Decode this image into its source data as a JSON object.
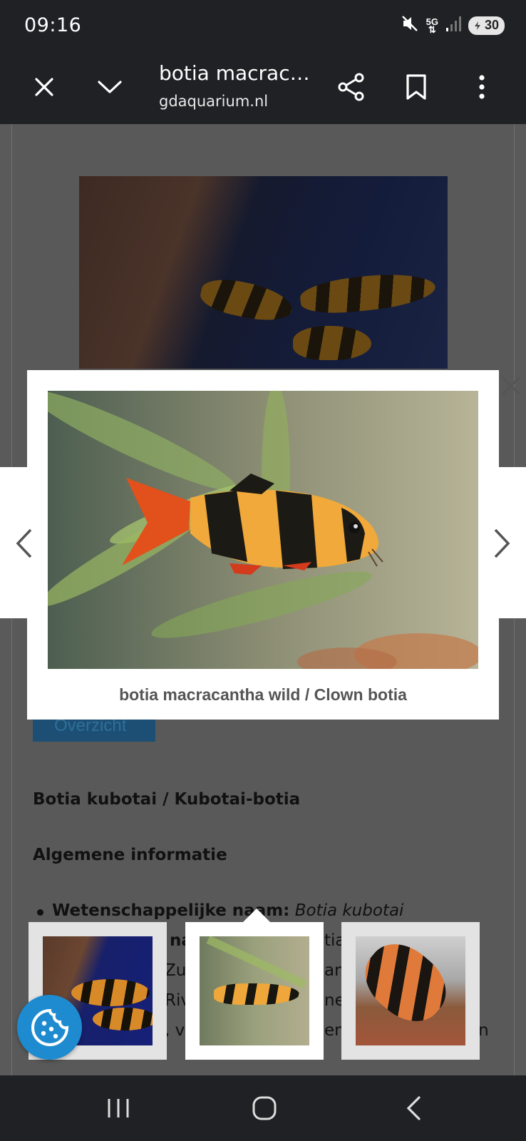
{
  "status_bar": {
    "time": "09:16",
    "network": "5G",
    "battery": "30",
    "icons": [
      "mute-icon",
      "5g-icon",
      "signal-icon",
      "battery-icon"
    ]
  },
  "browser": {
    "title": "botia macrac…",
    "domain": "gdaquarium.nl",
    "icons": [
      "close-icon",
      "chevron-down-icon",
      "share-icon",
      "bookmark-icon",
      "more-vert-icon"
    ]
  },
  "page": {
    "button_label": "Overzicht",
    "heading1": "Botia kubotai / Kubotai-botia",
    "heading2": "Algemene informatie",
    "bullet1_label": "Wetenschappelijke naam:",
    "bullet1_value": "Botia kubotai",
    "bullet2_visible": "na",
    "bullet2_tail": "tia",
    "bullet3_start": "Zuid",
    "bullet3_tail": "and",
    "bullet4_start": "Rivi",
    "bullet4_tail": "net z",
    "bullet5_start": ", vaa",
    "bullet5_tail": "en",
    "bullet5_end": "en"
  },
  "lightbox": {
    "caption": "botia macracantha wild / Clown botia",
    "icons": [
      "close-icon",
      "chevron-left-icon",
      "chevron-right-icon"
    ],
    "thumbnails_count": 3,
    "selected_thumbnail": 2
  },
  "colors": {
    "bar_bg": "#202124",
    "overlay": "#595959",
    "cookie_button": "#1e8bd0"
  }
}
